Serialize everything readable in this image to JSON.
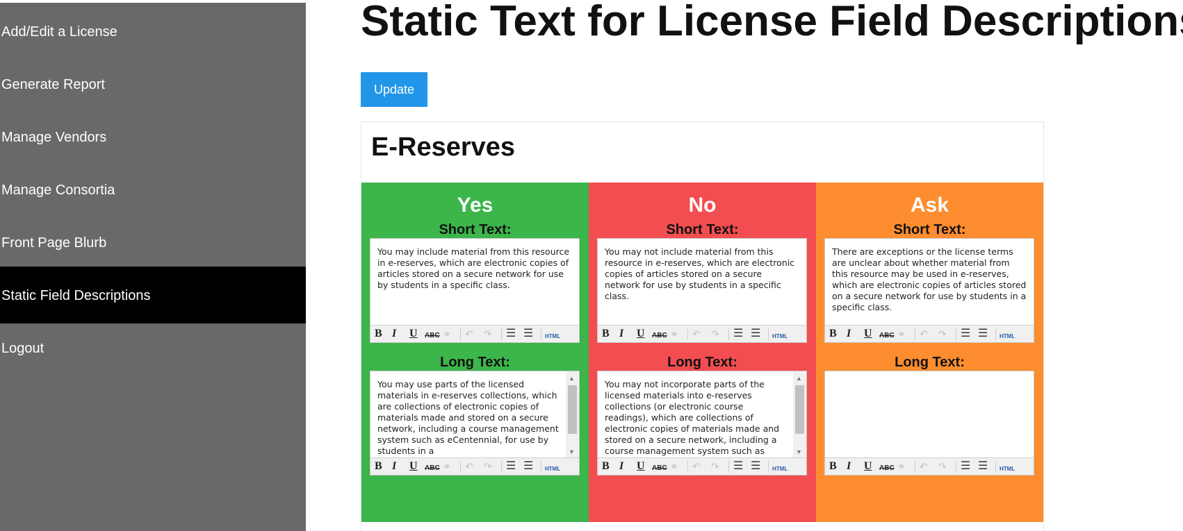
{
  "nav": {
    "items": [
      {
        "label": "Add/Edit a License"
      },
      {
        "label": "Generate Report"
      },
      {
        "label": "Manage Vendors"
      },
      {
        "label": "Manage Consortia"
      },
      {
        "label": "Front Page Blurb"
      },
      {
        "label": "Static Field Descriptions",
        "active": true
      },
      {
        "label": "Logout"
      }
    ]
  },
  "page": {
    "title": "Static Text for License Field Descriptions",
    "update_label": "Update"
  },
  "section": {
    "title": "E-Reserves",
    "short_label": "Short Text:",
    "long_label": "Long Text:",
    "columns": [
      {
        "heading": "Yes",
        "color": "#3cb54a",
        "short_text": "You may include material from this resource in e-reserves, which are electronic copies of articles stored on a secure network for use by students in a specific class.",
        "long_text": "You may use parts of the licensed materials in e-reserves collections, which are collections of electronic copies of materials made and stored on a secure network, including a course management system such as eCentennial, for use by students in a"
      },
      {
        "heading": "No",
        "color": "#f24d50",
        "short_text": "You may not include material from this resource in e-reserves, which are electronic copies of articles stored on a secure network for use by students in a specific class.",
        "long_text": "You may not incorporate parts of the licensed materials into e-reserves collections (or electronic course readings), which are collections of electronic copies of materials made and stored on a secure network, including a course management system such as"
      },
      {
        "heading": "Ask",
        "color": "#fd8d2f",
        "short_text": "There are exceptions or the license terms are unclear about whether material from this resource may be used in e-reserves, which are electronic copies of articles stored on a secure network for use by students in a specific class.",
        "long_text": ""
      }
    ]
  },
  "toolbar": {
    "bold": "B",
    "italic": "I",
    "underline": "U",
    "strike": "ABC",
    "link": "⚭",
    "undo": "↶",
    "redo": "↷",
    "bullets": "☰",
    "numbered": "☰",
    "html": "HTML"
  },
  "icons": {
    "bold": "bold-icon",
    "italic": "italic-icon",
    "underline": "underline-icon",
    "strike": "strikethrough-icon",
    "link": "link-icon",
    "undo": "undo-icon",
    "redo": "redo-icon",
    "bullets": "bullet-list-icon",
    "numbered": "numbered-list-icon",
    "html": "html-source-icon"
  }
}
